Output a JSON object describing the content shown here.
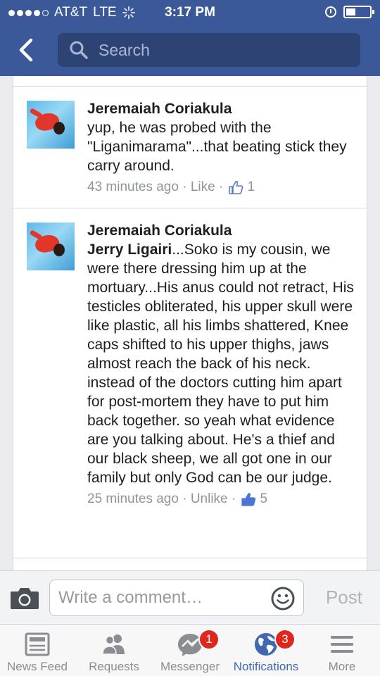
{
  "status_bar": {
    "carrier": "AT&T",
    "network": "LTE",
    "time": "3:17 PM"
  },
  "header": {
    "search_placeholder": "Search"
  },
  "comments": [
    {
      "author": "Jeremaiah Coriakula",
      "mention": "",
      "text": "yup, he was probed with the \"Liganimarama\"...that beating stick they carry around.",
      "time": "43 minutes ago",
      "action": "Like",
      "likes": "1"
    },
    {
      "author": "Jeremaiah Coriakula",
      "mention": "Jerry Ligairi",
      "text": "...Soko is my cousin, we were there dressing him up at the mortuary...His anus could not retract, His testicles obliterated, his upper skull were like plastic, all his limbs shattered, Knee caps shifted to his upper thighs, jaws almost reach the back of his neck. instead of the doctors cutting him apart for post-mortem they have to put him back together. so yeah what evidence are you  talking about. He's a thief and our black sheep, we all got one in our family but only God can be our judge.",
      "time": "25 minutes ago",
      "action": "Unlike",
      "likes": "5"
    }
  ],
  "composer": {
    "placeholder": "Write a comment…",
    "post_label": "Post"
  },
  "tabs": [
    {
      "label": "News Feed",
      "badge": ""
    },
    {
      "label": "Requests",
      "badge": ""
    },
    {
      "label": "Messenger",
      "badge": "1"
    },
    {
      "label": "Notifications",
      "badge": "3"
    },
    {
      "label": "More",
      "badge": ""
    }
  ],
  "colors": {
    "brand": "#3b5998",
    "active_tab": "#4267b2",
    "badge": "#e0271d"
  }
}
